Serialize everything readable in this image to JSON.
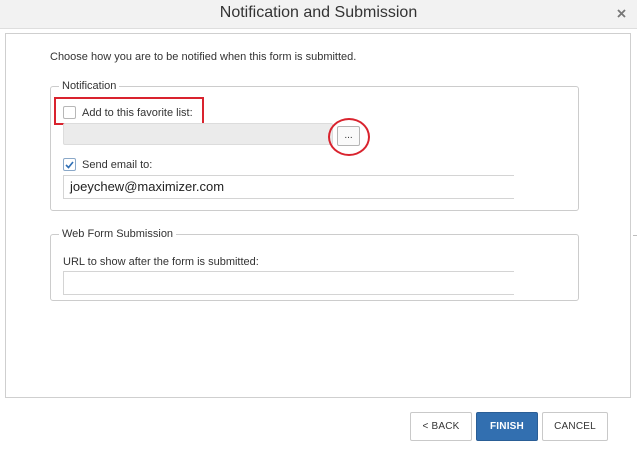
{
  "dialog": {
    "title": "Notification and Submission",
    "close_glyph": "×"
  },
  "intro_text": "Choose how you are to be notified when this form is submitted.",
  "notification": {
    "legend": "Notification",
    "favorite_list": {
      "label": "Add to this favorite list:",
      "checked": false,
      "value": "",
      "browse_label": "..."
    },
    "send_email": {
      "label": "Send email to:",
      "checked": true,
      "value": "joeychew@maximizer.com"
    }
  },
  "web_form_submission": {
    "legend": "Web Form Submission",
    "url_label": "URL to show after the form is submitted:",
    "url_value": ""
  },
  "buttons": {
    "back": "< BACK",
    "finish": "FINISH",
    "cancel": "CANCEL"
  },
  "colors": {
    "accent": "#326fb0",
    "highlight": "#d9232e",
    "check": "#2f6fb5"
  },
  "icons": {
    "close": "close-icon",
    "check": "checkmark-icon"
  }
}
